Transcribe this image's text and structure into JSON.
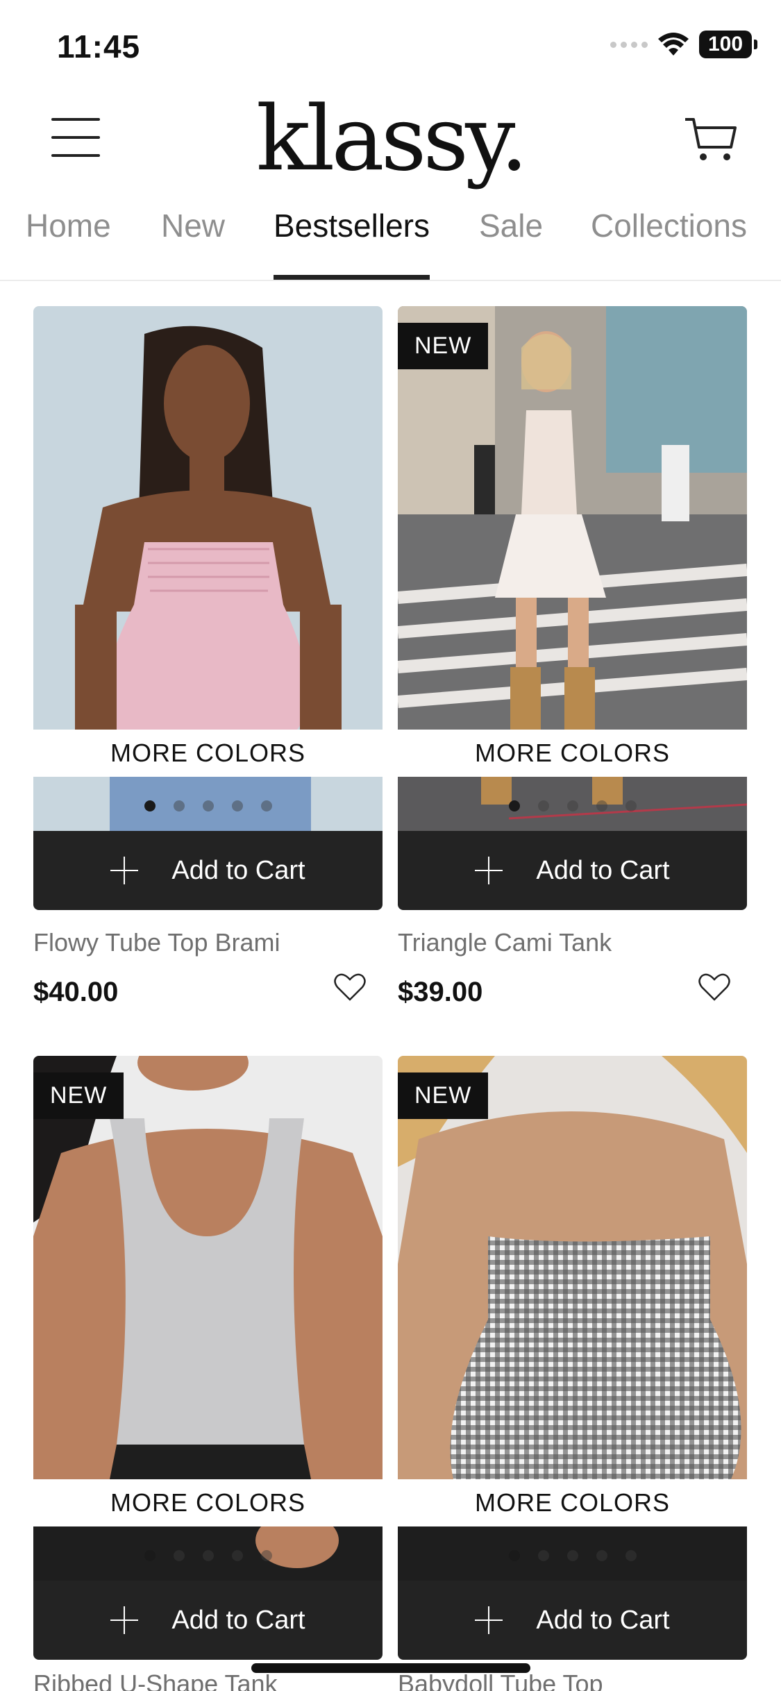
{
  "status": {
    "time": "11:45",
    "battery": "100"
  },
  "header": {
    "logo": "klassy."
  },
  "tabs": [
    {
      "label": "Home"
    },
    {
      "label": "New"
    },
    {
      "label": "Bestsellers"
    },
    {
      "label": "Sale"
    },
    {
      "label": "Collections"
    }
  ],
  "products": [
    {
      "badge": "",
      "more_colors": "MORE COLORS",
      "add_to_cart": "Add to Cart",
      "name": "Flowy Tube Top Brami",
      "price": "$40.00"
    },
    {
      "badge": "NEW",
      "more_colors": "MORE COLORS",
      "add_to_cart": "Add to Cart",
      "name": "Triangle Cami Tank",
      "price": "$39.00"
    },
    {
      "badge": "NEW",
      "more_colors": "MORE COLORS",
      "add_to_cart": "Add to Cart",
      "name": "Ribbed U-Shape Tank",
      "price": ""
    },
    {
      "badge": "NEW",
      "more_colors": "MORE COLORS",
      "add_to_cart": "Add to Cart",
      "name": "Babydoll Tube Top",
      "price": ""
    }
  ],
  "icons": {
    "menu": "hamburger-menu-icon",
    "cart": "shopping-cart-icon",
    "heart": "heart-outline-icon",
    "plus": "plus-icon"
  },
  "colors": {
    "button_bg": "#232323",
    "active_tab": "#111111",
    "inactive_tab": "#8e8e8e"
  }
}
